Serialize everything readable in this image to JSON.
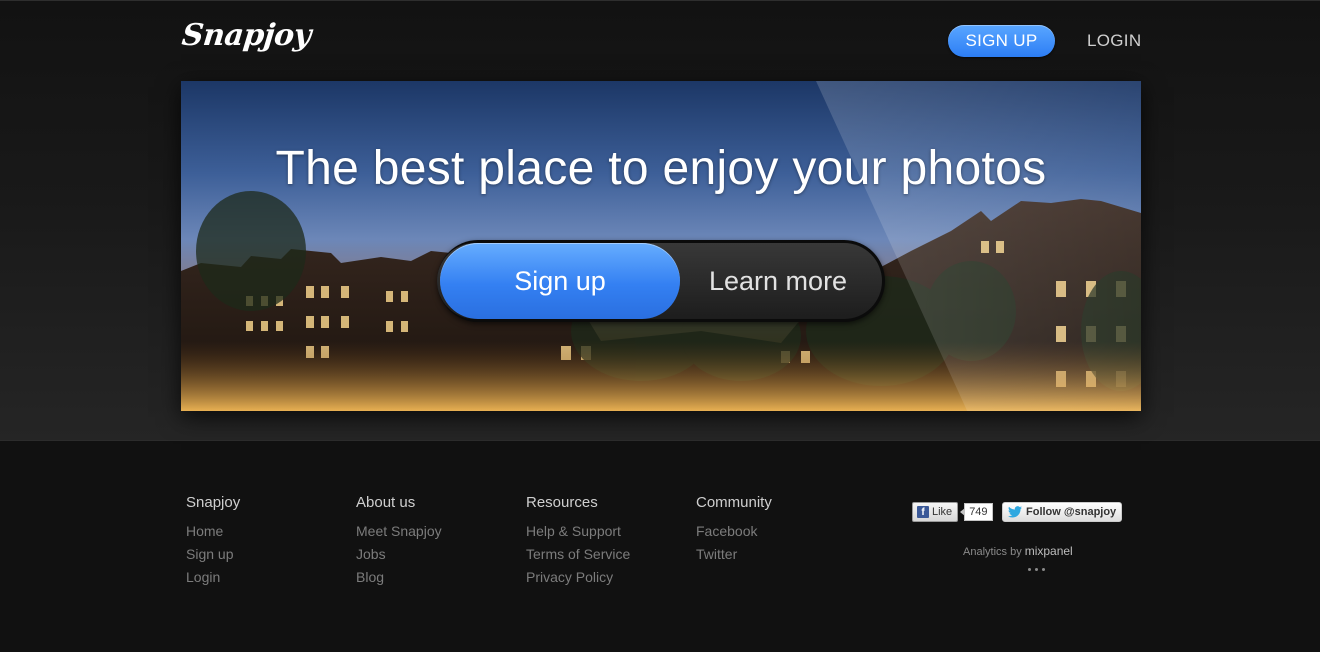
{
  "header": {
    "logo_text": "Snapjoy",
    "signup_label": "SIGN UP",
    "login_label": "LOGIN"
  },
  "hero": {
    "title": "The best place to enjoy your photos",
    "signup_label": "Sign up",
    "learn_more_label": "Learn more"
  },
  "footer": {
    "columns": [
      {
        "heading": "Snapjoy",
        "links": [
          "Home",
          "Sign up",
          "Login"
        ]
      },
      {
        "heading": "About us",
        "links": [
          "Meet Snapjoy",
          "Jobs",
          "Blog"
        ]
      },
      {
        "heading": "Resources",
        "links": [
          "Help & Support",
          "Terms of Service",
          "Privacy Policy"
        ]
      },
      {
        "heading": "Community",
        "links": [
          "Facebook",
          "Twitter"
        ]
      }
    ],
    "social": {
      "fb_like_label": "Like",
      "fb_like_count": "749",
      "twitter_follow_label": "Follow @snapjoy"
    },
    "analytics_label": "Analytics by",
    "analytics_brand": "mixpanel"
  },
  "colors": {
    "background": "#111111",
    "accent_blue": "#3480f2",
    "footer_link": "#7c7c7c"
  },
  "icons": [
    "facebook-icon",
    "twitter-bird-icon"
  ]
}
